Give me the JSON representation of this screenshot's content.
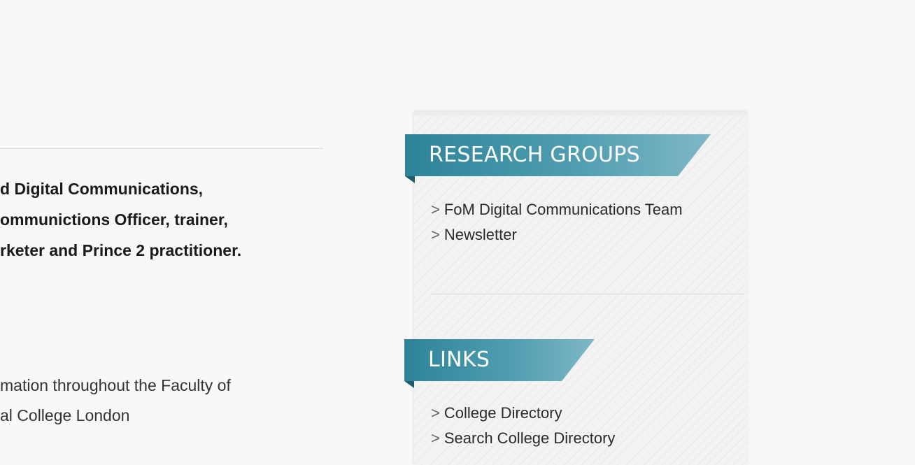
{
  "main": {
    "intro_lines": [
      "d Digital Communications,",
      "ommunictions Officer, trainer,",
      "rketer and Prince 2 practitioner."
    ],
    "desc_lines": [
      "mation throughout the Faculty of",
      "al College London"
    ]
  },
  "sidebar": {
    "research": {
      "title": "RESEARCH GROUPS",
      "items": [
        {
          "arrow": ">",
          "label": "FoM Digital Communications Team"
        },
        {
          "arrow": ">",
          "label": "Newsletter"
        }
      ]
    },
    "links": {
      "title": "LINKS",
      "items": [
        {
          "arrow": ">",
          "label": "College Directory"
        },
        {
          "arrow": ">",
          "label": "Search College Directory"
        }
      ]
    }
  },
  "colors": {
    "ribbon_start": "#2e8398",
    "ribbon_end": "#7fb8c6",
    "ribbon_fold": "#1f5d6d",
    "page_background": "#f8f8f8"
  }
}
